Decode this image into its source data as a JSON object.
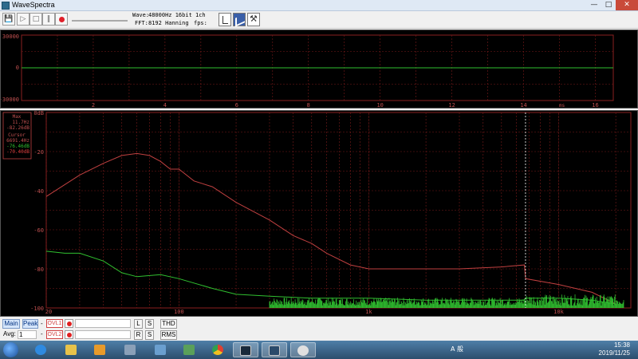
{
  "window": {
    "title": "WaveSpectra",
    "minimize": "—",
    "maximize": "□",
    "close": "✕"
  },
  "toolbar": {
    "wave_label": "Wave:",
    "wave_value": "48000Hz 16bit 1ch",
    "fft_label": "FFT:",
    "fft_value": "8192 Hanning",
    "fps_label": "fps:",
    "fps_value": ""
  },
  "scope": {
    "y_labels": [
      "30000",
      "0",
      "-30000"
    ],
    "x_labels": [
      "2",
      "4",
      "6",
      "8",
      "10",
      "12",
      "14",
      "16"
    ],
    "x_unit": "ms"
  },
  "spectrum": {
    "max_title": "Max",
    "max_freq": "11.7Hz",
    "max_db": "-82.26dB",
    "cursor_title": "Cursor",
    "cursor_freq": "6691.4Hz",
    "cursor_db_green": "-76.46dB",
    "cursor_db_red": "-70.40dB",
    "y_labels": [
      "0dB",
      "-20",
      "-40",
      "-60",
      "-80",
      "-100"
    ],
    "x_labels": [
      "20",
      "100",
      "1k",
      "10k"
    ]
  },
  "chart_data": {
    "type": "line",
    "title": "",
    "xlabel": "",
    "ylabel": "",
    "x_scale": "log",
    "xlim": [
      20,
      24000
    ],
    "ylim": [
      -100,
      0
    ],
    "grid": true,
    "series": [
      {
        "color": "#c04040",
        "x": [
          20,
          30,
          40,
          50,
          60,
          70,
          80,
          90,
          100,
          120,
          150,
          200,
          300,
          400,
          500,
          600,
          800,
          1000,
          2000,
          3000,
          5000,
          6600,
          6700,
          10000,
          15000,
          20000
        ],
        "y": [
          -43,
          -32,
          -26,
          -22,
          -21,
          -22,
          -25,
          -29,
          -29,
          -35,
          -38,
          -46,
          -55,
          -63,
          -67,
          -72,
          -78,
          -80,
          -80,
          -80,
          -79,
          -78,
          -85,
          -88,
          -92,
          -98
        ]
      },
      {
        "color": "#30c030",
        "x": [
          20,
          25,
          30,
          40,
          50,
          60,
          80,
          100,
          150,
          200,
          300,
          500,
          800,
          1000,
          2000,
          5000,
          6600,
          6700,
          10000,
          15000,
          20000
        ],
        "y": [
          -71,
          -72,
          -72,
          -76,
          -82,
          -84,
          -83,
          -85,
          -90,
          -93,
          -94,
          -95,
          -95,
          -95,
          -96,
          -96,
          -96,
          -95,
          -95,
          -96,
          -98
        ]
      }
    ]
  },
  "bottom": {
    "main": "Main",
    "peak": "Peak",
    "avg_label": "Avg:",
    "avg_value": "1",
    "ovl1": "OVL1",
    "ovl2": "OVL2",
    "l": "L",
    "s": "S",
    "r": "R",
    "thd": "THD",
    "rms": "RMS"
  },
  "taskbar": {
    "time": "15:38",
    "date": "2019/11/25",
    "tray_text": "A 般"
  }
}
